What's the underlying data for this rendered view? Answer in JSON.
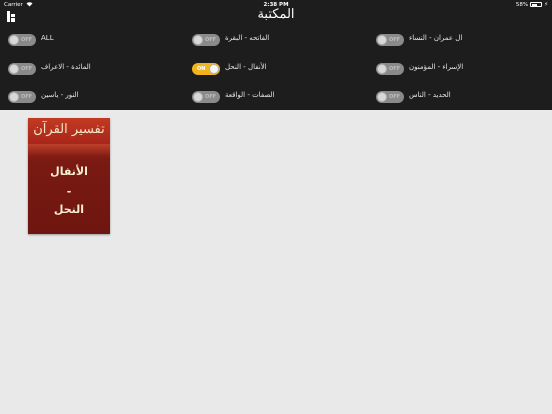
{
  "status": {
    "carrier": "Carrier",
    "time": "2:38 PM",
    "battery": "58%"
  },
  "header": {
    "title": "المكتبة"
  },
  "filters": [
    {
      "label": "ALL",
      "state": "OFF"
    },
    {
      "label": "الفاتحه - البقرة",
      "state": "OFF"
    },
    {
      "label": "ال عمران - النساء",
      "state": "OFF"
    },
    {
      "label": "المائدة - الاعراف",
      "state": "OFF"
    },
    {
      "label": "الأنفال - النحل",
      "state": "ON"
    },
    {
      "label": "الإسراء - المؤمنون",
      "state": "OFF"
    },
    {
      "label": "النور - ياسين",
      "state": "OFF"
    },
    {
      "label": "الصفات - الواقعة",
      "state": "OFF"
    },
    {
      "label": "الحديد - الناس",
      "state": "OFF"
    }
  ],
  "book": {
    "series": "تفسير القرآن",
    "line1": "الأنفال",
    "line2": "-",
    "line3": "النحل"
  },
  "colors": {
    "header_bg": "#1d1d1d",
    "toggle_on": "#f3b51c",
    "toggle_off": "#8a8a8a",
    "page_bg": "#e9e9e9"
  }
}
